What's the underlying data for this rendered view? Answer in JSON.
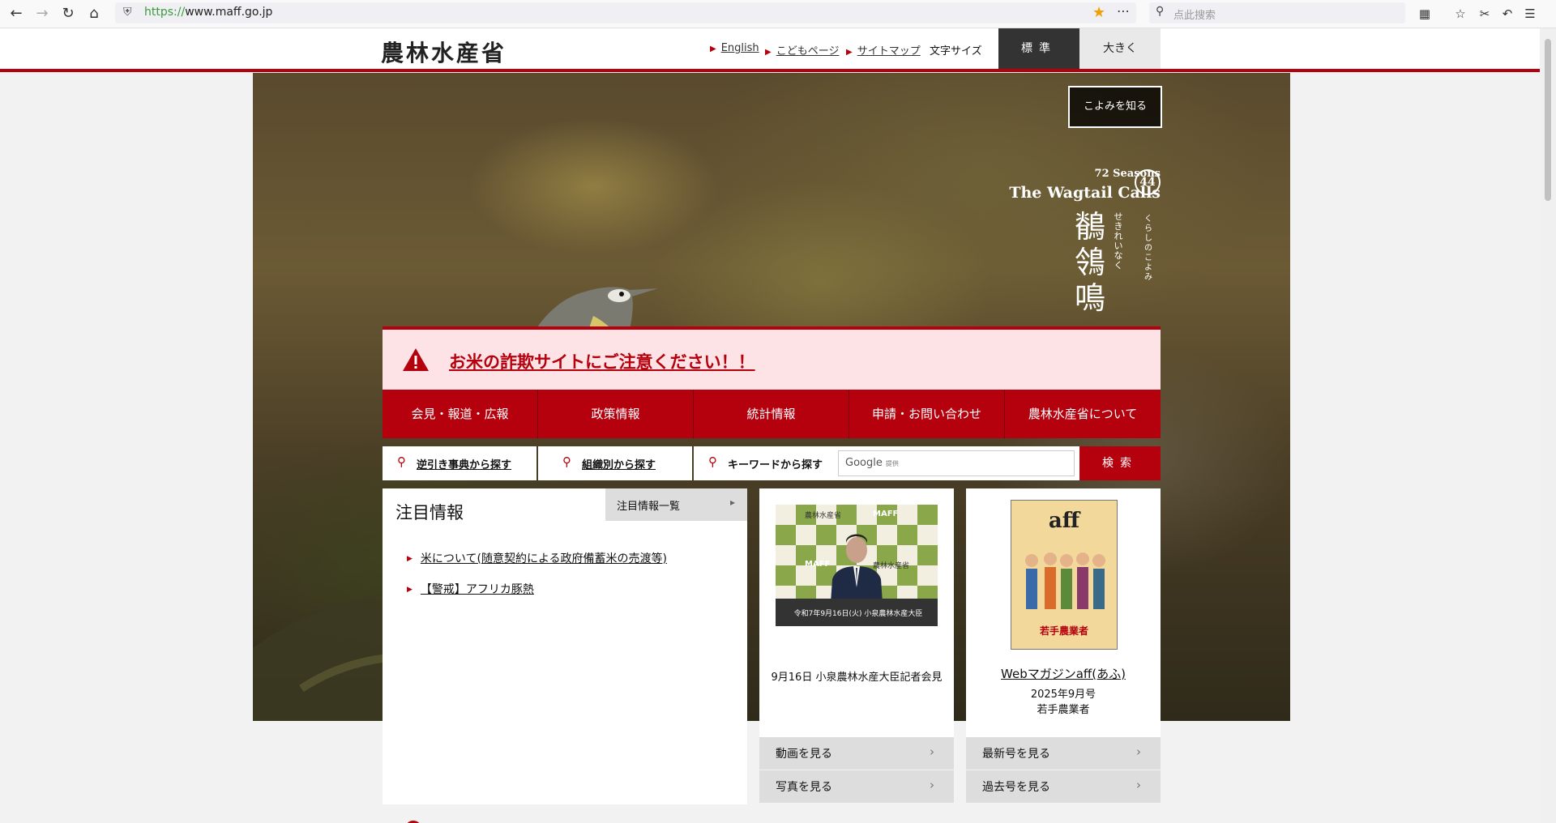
{
  "browser": {
    "url_scheme": "https://",
    "url_host": "www.maff.go.jp",
    "search_placeholder": "点此搜索"
  },
  "header": {
    "logo": "農林水産省",
    "links": [
      "English",
      "こどもページ",
      "サイトマップ"
    ],
    "font_size_label": "文字サイズ",
    "font_size_standard": "標準",
    "font_size_large": "大きく"
  },
  "hero": {
    "koyomi_button": "こよみを知る",
    "seasons_small": "72 Seasons",
    "seasons_title": "The Wagtail Calls",
    "season_number": "44",
    "kanji": [
      "鶺",
      "鴒",
      "鳴"
    ],
    "kanji_reading": "せきれいなく",
    "kurashi": "くらしのこよみ"
  },
  "alert": {
    "text": "お米の詐欺サイトにご注意ください！！"
  },
  "nav": {
    "items": [
      "会見・報道・広報",
      "政策情報",
      "統計情報",
      "申請・お問い合わせ",
      "農林水産省について"
    ]
  },
  "search": {
    "reverse_dict": "逆引き事典から探す",
    "by_org": "組織別から探す",
    "keyword": "キーワードから探す",
    "google": "Google",
    "google_sub": "提供",
    "button": "検索"
  },
  "attention": {
    "title": "注目情報",
    "list_link": "注目情報一覧",
    "items": [
      "米について(随意契約による政府備蓄米の売渡等)",
      "【警戒】アフリカ豚熱"
    ]
  },
  "video_card": {
    "photo_caption": "令和7年9月16日(火) 小泉農林水産大臣",
    "caption": "9月16日 小泉農林水産大臣記者会見",
    "btn_video": "動画を見る",
    "btn_photo": "写真を見る",
    "backdrop_text": [
      "農林水産省",
      "MAFF"
    ]
  },
  "magazine_card": {
    "cover_title": "aff",
    "cover_sub": "若手農業者",
    "link": "Webマガジンaff(あふ)",
    "date": "2025年9月号",
    "topic": "若手農業者",
    "btn_latest": "最新号を見る",
    "btn_back": "過去号を見る"
  },
  "colors": {
    "brand_red": "#b5000d",
    "alert_bg": "#fde3e5"
  }
}
